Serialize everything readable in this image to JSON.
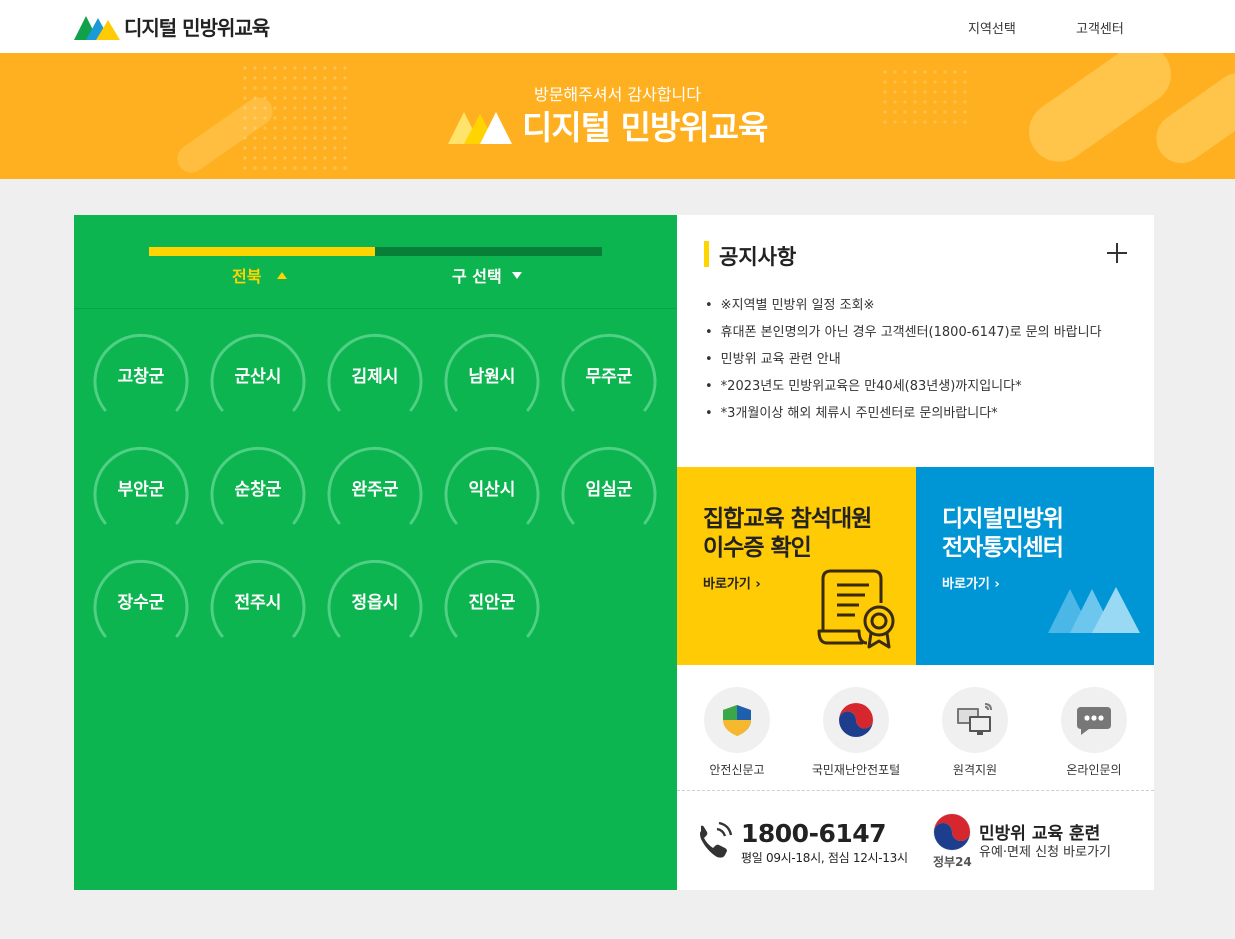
{
  "header": {
    "logo_text": "디지털 민방위교육",
    "nav": {
      "region_select": "지역선택",
      "customer_center": "고객센터"
    }
  },
  "banner": {
    "subtitle": "방문해주셔서 감사합니다",
    "title": "디지털 민방위교육"
  },
  "region_panel": {
    "tabs": {
      "province": "전북",
      "district": "구 선택"
    },
    "regions": [
      "고창군",
      "군산시",
      "김제시",
      "남원시",
      "무주군",
      "부안군",
      "순창군",
      "완주군",
      "익산시",
      "임실군",
      "장수군",
      "전주시",
      "정읍시",
      "진안군"
    ]
  },
  "notice": {
    "title": "공지사항",
    "items": [
      "※지역별 민방위 일정 조회※",
      "휴대폰 본인명의가 아닌 경우 고객센터(1800-6147)로 문의 바랍니다",
      "민방위 교육 관련 안내",
      "*2023년도 민방위교육은 만40세(83년생)까지입니다*",
      "*3개월이상 해외 체류시 주민센터로 문의바랍니다*"
    ]
  },
  "cards": {
    "certificate": {
      "line1": "집합교육 참석대원",
      "line2": "이수증 확인",
      "link": "바로가기"
    },
    "notification": {
      "line1": "디지털민방위",
      "line2": "전자통지센터",
      "link": "바로가기"
    }
  },
  "quick_links": [
    {
      "label": "안전신문고",
      "icon": "shield-icon"
    },
    {
      "label": "국민재난안전포털",
      "icon": "taegeuk-icon"
    },
    {
      "label": "원격지원",
      "icon": "remote-monitor-icon"
    },
    {
      "label": "온라인문의",
      "icon": "chat-bubble-icon"
    }
  ],
  "contact": {
    "phone": "1800-6147",
    "hours": "평일 09시-18시, 점심 12시-13시"
  },
  "gov24": {
    "brand": "정부24",
    "title": "민방위 교육 훈련",
    "subtitle": "유예·면제 신청 바로가기"
  },
  "colors": {
    "banner": "#ffb020",
    "region_panel": "#0db550",
    "accent_yellow": "#ffd400",
    "card_yellow": "#ffcb05",
    "card_blue": "#0095d5"
  }
}
